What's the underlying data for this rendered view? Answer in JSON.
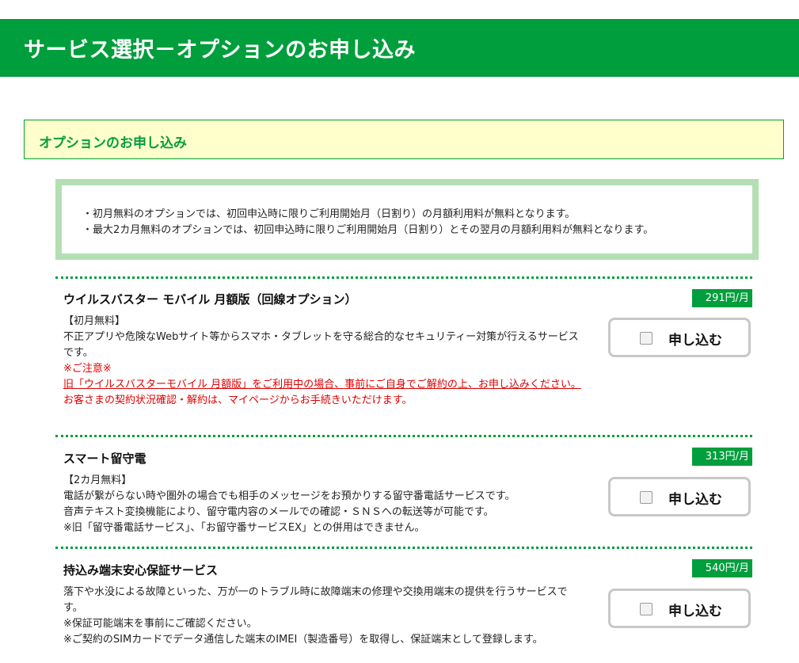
{
  "header": {
    "title": "サービス選択－オプションのお申し込み"
  },
  "section": {
    "title": "オプションのお申し込み"
  },
  "notice": {
    "lines": [
      "・初月無料のオプションでは、初回申込時に限りご利用開始月（日割り）の月額利用料が無料となります。",
      "・最大2カ月無料のオプションでは、初回申込時に限りご利用開始月（日割り）とその翌月の月額利用料が無料となります。"
    ]
  },
  "options": [
    {
      "title": "ウイルスバスター モバイル 月額版（回線オプション）",
      "price": "291円/月",
      "button_label": "申し込む",
      "desc": [
        "【初月無料】",
        "不正アプリや危険なWebサイト等からスマホ・タブレットを守る総合的なセキュリティー対策が行えるサービスです。"
      ],
      "caution_title": "※ご注意※",
      "caution_link": "旧「ウイルスバスターモバイル 月額版」をご利用中の場合、事前にご自身でご解約の上、お申し込みください。",
      "caution_note": "お客さまの契約状況確認・解約は、マイページからお手続きいただけます。"
    },
    {
      "title": "スマート留守電",
      "price": "313円/月",
      "button_label": "申し込む",
      "desc": [
        "【2カ月無料】",
        "電話が繋がらない時や圏外の場合でも相手のメッセージをお預かりする留守番電話サービスです。",
        "音声テキスト変換機能により、留守電内容のメールでの確認・ＳＮＳへの転送等が可能です。",
        "※旧「留守番電話サービス」、「お留守番サービスEX」との併用はできません。"
      ]
    },
    {
      "title": "持込み端末安心保証サービス",
      "price": "540円/月",
      "button_label": "申し込む",
      "desc": [
        "落下や水没による故障といった、万が一のトラブル時に故障端末の修理や交換用端末の提供を行うサービスです。",
        "※保証可能端末を事前にご確認ください。",
        "※ご契約のSIMカードでデータ通信した端末のIMEI（製造番号）を取得し、保証端末として登録します。"
      ]
    }
  ],
  "colors": {
    "brand_green": "#009e3c",
    "notice_border": "#b3dfb3",
    "section_bg": "#ffffcc",
    "caution_red": "#e00000"
  }
}
